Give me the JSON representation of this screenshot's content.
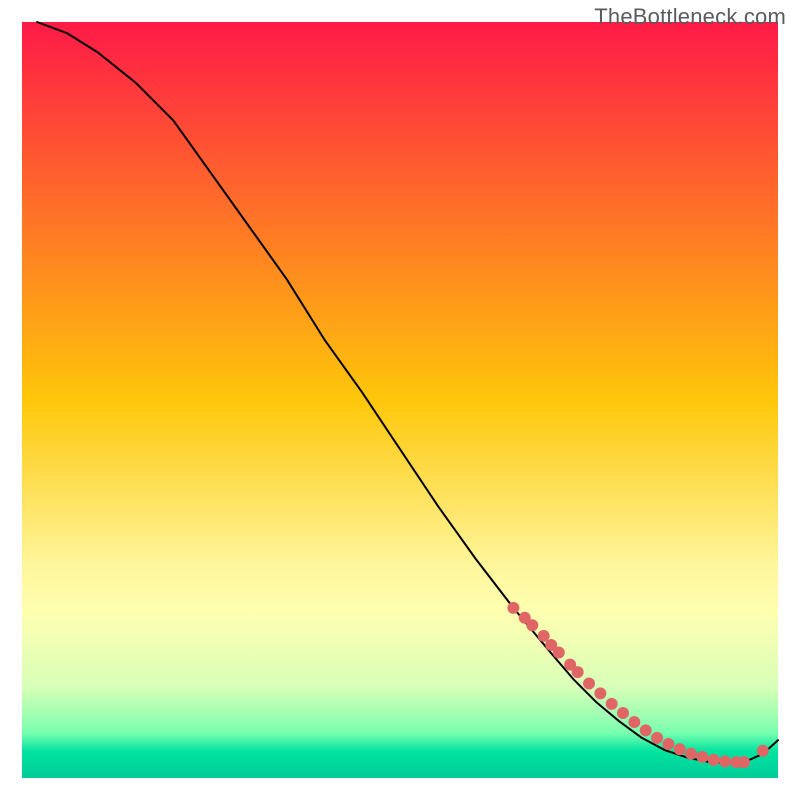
{
  "watermark": "TheBottleneck.com",
  "chart_data": {
    "type": "line",
    "title": "",
    "xlabel": "",
    "ylabel": "",
    "xlim": [
      0,
      100
    ],
    "ylim": [
      0,
      100
    ],
    "grid": false,
    "legend": false,
    "gradient_stops": [
      {
        "offset": 0.0,
        "color": "#ff1a47"
      },
      {
        "offset": 0.5,
        "color": "#ffc70a"
      },
      {
        "offset": 0.72,
        "color": "#fff69c"
      },
      {
        "offset": 0.78,
        "color": "#ffffb0"
      },
      {
        "offset": 0.88,
        "color": "#d9ffb8"
      },
      {
        "offset": 0.94,
        "color": "#7affaf"
      },
      {
        "offset": 0.965,
        "color": "#00e3a0"
      },
      {
        "offset": 1.0,
        "color": "#00cc99"
      }
    ],
    "series": [
      {
        "name": "curve",
        "type": "line",
        "color": "#000000",
        "x": [
          2,
          6,
          10,
          15,
          20,
          25,
          30,
          35,
          40,
          45,
          50,
          55,
          60,
          65,
          70,
          73,
          76,
          79,
          82,
          85,
          88,
          91,
          94,
          96,
          98,
          100
        ],
        "y": [
          100,
          98.5,
          96,
          92,
          87,
          80,
          73,
          66,
          58,
          51,
          43.5,
          36,
          29,
          22.5,
          16.5,
          13,
          10,
          7.5,
          5.3,
          3.7,
          2.7,
          2.1,
          2.0,
          2.3,
          3.2,
          5.0
        ]
      },
      {
        "name": "dots",
        "type": "scatter",
        "color": "#e06666",
        "x": [
          65,
          66.5,
          67.5,
          69,
          70,
          71,
          72.5,
          73.5,
          75,
          76.5,
          78,
          79.5,
          81,
          82.5,
          84,
          85.5,
          87,
          88.5,
          90,
          91.5,
          93,
          94.5,
          95.5,
          98
        ],
        "y": [
          22.5,
          21.2,
          20.2,
          18.8,
          17.6,
          16.6,
          15.0,
          14.0,
          12.5,
          11.2,
          9.8,
          8.6,
          7.4,
          6.3,
          5.3,
          4.5,
          3.8,
          3.2,
          2.8,
          2.4,
          2.2,
          2.1,
          2.1,
          3.6
        ]
      }
    ]
  }
}
